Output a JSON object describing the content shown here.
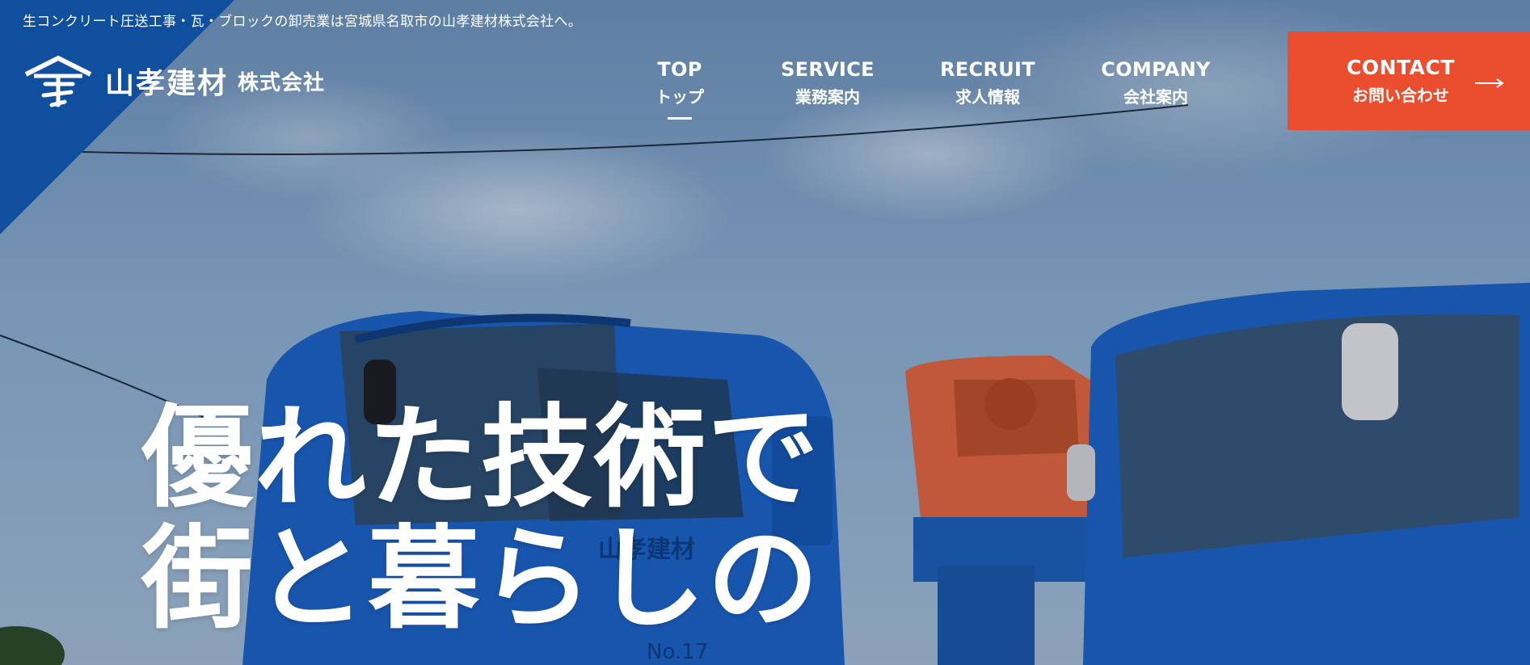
{
  "tagline": "生コンクリート圧送工事・瓦・ブロックの卸売業は宮城県名取市の山孝建材株式会社へ。",
  "logo": {
    "name": "山孝建材",
    "corp": "株式会社",
    "icon": "company-logo-mark"
  },
  "nav": [
    {
      "en": "TOP",
      "jp": "トップ",
      "active": true
    },
    {
      "en": "SERVICE",
      "jp": "業務案内",
      "active": false
    },
    {
      "en": "RECRUIT",
      "jp": "求人情報",
      "active": false
    },
    {
      "en": "COMPANY",
      "jp": "会社案内",
      "active": false
    }
  ],
  "contact": {
    "en": "CONTACT",
    "jp": "お問い合わせ",
    "icon": "arrow-right-icon"
  },
  "hero": {
    "lines": [
      "優れた技術で",
      "街と暮らしの"
    ],
    "truck_door_text": "山孝建材",
    "truck_number": "No.17"
  },
  "colors": {
    "brand_blue": "#0f4f9e",
    "contact_orange": "#eb4e2e",
    "text": "#ffffff"
  }
}
